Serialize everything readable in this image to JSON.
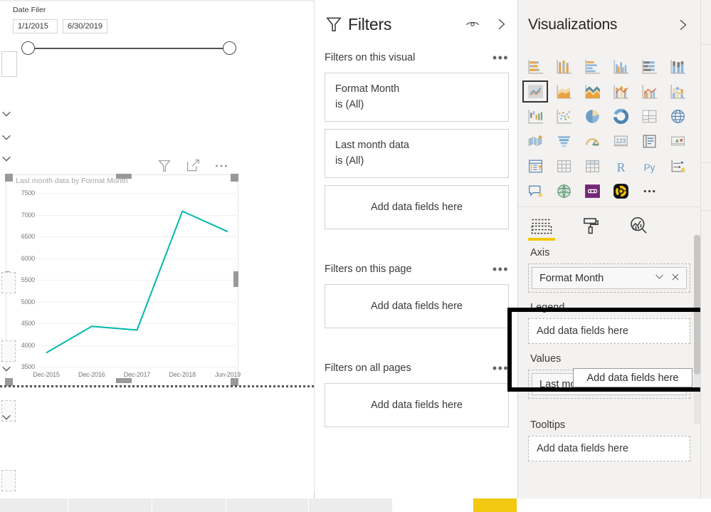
{
  "canvas": {
    "slicer": {
      "title": "Date Filer",
      "start_value": "1/1/2015",
      "end_value": "6/30/2019"
    },
    "visual_header": {
      "filter_icon": "funnel-icon",
      "focus_icon": "focus-mode-icon",
      "more_icon": "more-options-icon"
    }
  },
  "chart_data": {
    "type": "line",
    "title": "Last month data by Format Month",
    "xlabel": "",
    "ylabel": "",
    "categories": [
      "Dec-2015",
      "Dec-2016",
      "Dec-2017",
      "Dec-2018",
      "Jun-2019"
    ],
    "values": [
      3820,
      4430,
      4345,
      7080,
      6610
    ],
    "yticks": [
      3500,
      4000,
      4500,
      5000,
      5500,
      6000,
      6500,
      7000,
      7500
    ],
    "ylim": [
      3500,
      7500
    ],
    "grid": true,
    "legend": "none",
    "series_color": "#01B8AA",
    "series_name": "Last month data"
  },
  "filters": {
    "title": "Filters",
    "funnel_icon": "funnel-icon",
    "eye_icon": "eye-icon",
    "collapse_icon": "chevron-right-icon",
    "groups": [
      {
        "label": "Filters on this visual",
        "menu": "•••",
        "cards": [
          {
            "name": "Format Month",
            "value": "is (All)"
          },
          {
            "name": "Last month data",
            "value": "is (All)"
          }
        ],
        "dropzone": "Add data fields here"
      },
      {
        "label": "Filters on this page",
        "menu": "•••",
        "cards": [],
        "dropzone": "Add data fields here"
      },
      {
        "label": "Filters on all pages",
        "menu": "•••",
        "cards": [],
        "dropzone": "Add data fields here"
      }
    ]
  },
  "visualizations": {
    "title": "Visualizations",
    "collapse_icon": "chevron-right-icon",
    "gallery": [
      [
        {
          "name": "stacked-bar-chart-icon",
          "selected": false
        },
        {
          "name": "stacked-column-chart-icon",
          "selected": false
        },
        {
          "name": "clustered-bar-chart-icon",
          "selected": false
        },
        {
          "name": "clustered-column-chart-icon",
          "selected": false
        },
        {
          "name": "100-percent-stacked-bar-chart-icon",
          "selected": false
        },
        {
          "name": "100-percent-stacked-column-chart-icon",
          "selected": false
        }
      ],
      [
        {
          "name": "line-chart-icon",
          "selected": true
        },
        {
          "name": "area-chart-icon",
          "selected": false
        },
        {
          "name": "stacked-area-chart-icon",
          "selected": false
        },
        {
          "name": "line-and-stacked-column-chart-icon",
          "selected": false
        },
        {
          "name": "line-and-clustered-column-chart-icon",
          "selected": false
        },
        {
          "name": "ribbon-chart-icon",
          "selected": false
        }
      ],
      [
        {
          "name": "waterfall-chart-icon",
          "selected": false
        },
        {
          "name": "scatter-chart-icon",
          "selected": false
        },
        {
          "name": "pie-chart-icon",
          "selected": false
        },
        {
          "name": "donut-chart-icon",
          "selected": false
        },
        {
          "name": "treemap-icon",
          "selected": false
        },
        {
          "name": "map-icon",
          "selected": false
        }
      ],
      [
        {
          "name": "filled-map-icon",
          "selected": false
        },
        {
          "name": "funnel-chart-icon",
          "selected": false
        },
        {
          "name": "gauge-chart-icon",
          "selected": false
        },
        {
          "name": "card-icon",
          "selected": false
        },
        {
          "name": "multi-row-card-icon",
          "selected": false
        },
        {
          "name": "kpi-icon",
          "selected": false
        }
      ],
      [
        {
          "name": "slicer-icon",
          "selected": false
        },
        {
          "name": "table-icon",
          "selected": false
        },
        {
          "name": "matrix-icon",
          "selected": false
        },
        {
          "name": "r-script-visual-icon",
          "selected": false
        },
        {
          "name": "python-visual-icon",
          "selected": false
        },
        {
          "name": "key-influencers-icon",
          "selected": false
        }
      ],
      [
        {
          "name": "qna-visual-icon",
          "selected": false
        },
        {
          "name": "arcgis-map-icon",
          "selected": false
        },
        {
          "name": "power-apps-visual-icon",
          "selected": false
        },
        {
          "name": "custom-visual-icon",
          "selected": false
        },
        {
          "name": "more-visuals-icon",
          "selected": false
        }
      ]
    ],
    "tabs": [
      {
        "name": "fields-tab",
        "icon": "fields-icon",
        "active": true
      },
      {
        "name": "format-tab",
        "icon": "paint-roller-icon",
        "active": false
      },
      {
        "name": "analytics-tab",
        "icon": "analytics-magnifier-icon",
        "active": false
      }
    ],
    "wells": [
      {
        "label": "Axis",
        "pill": "Format Month",
        "pill_chevron": "chevron-down-icon",
        "pill_remove": "close-icon",
        "placeholder": null
      },
      {
        "label": "Legend",
        "pill": null,
        "placeholder": "Add data fields here"
      },
      {
        "label": "Values",
        "pill": "Last month data",
        "pill_chevron": "chevron-down-icon",
        "pill_remove": "close-icon",
        "placeholder": null
      },
      {
        "label": "Tooltips",
        "pill": null,
        "placeholder": "Add data fields here"
      }
    ],
    "tooltip_overlay": "Add data fields here"
  },
  "colors": {
    "series": "#01B8AA",
    "accent_yellow": "#F2C811",
    "pane_background": "#F3F2F1",
    "highlight_box": "#000000"
  }
}
